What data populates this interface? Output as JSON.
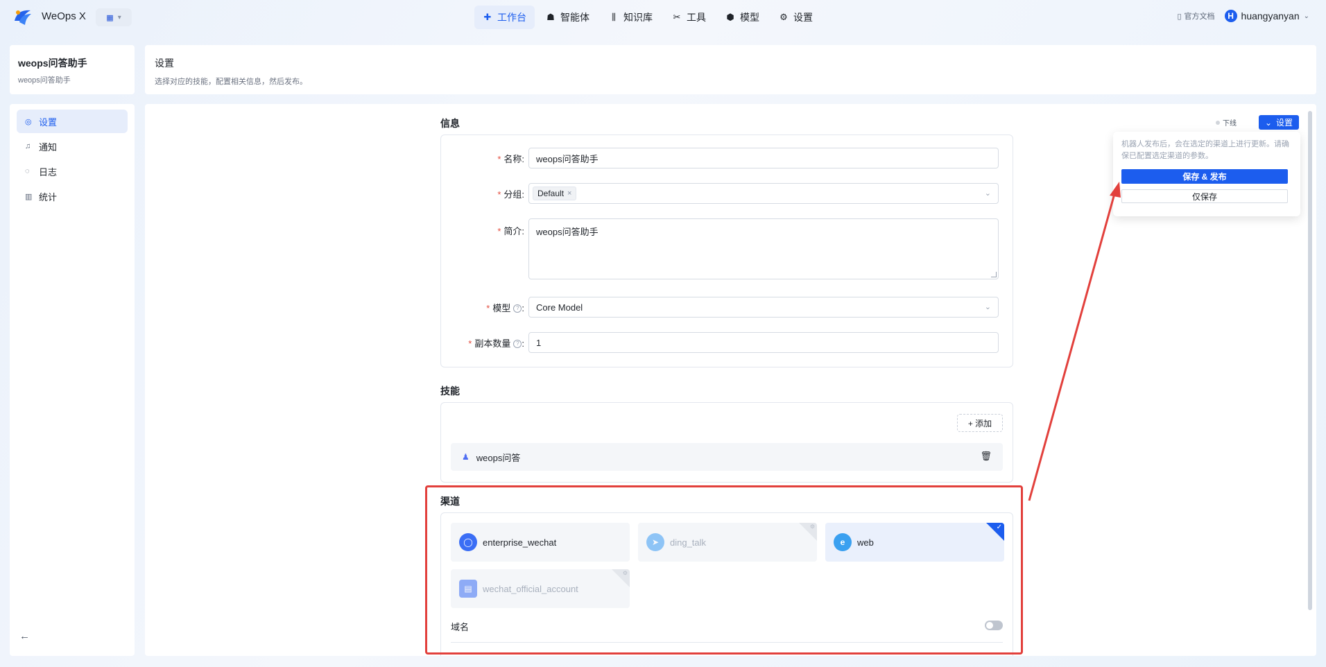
{
  "app": {
    "title": "WeOps X"
  },
  "nav": [
    {
      "label": "工作台",
      "icon": "robot-icon"
    },
    {
      "label": "智能体",
      "icon": "agent-icon"
    },
    {
      "label": "知识库",
      "icon": "library-icon"
    },
    {
      "label": "工具",
      "icon": "tools-icon"
    },
    {
      "label": "模型",
      "icon": "cube-icon"
    },
    {
      "label": "设置",
      "icon": "gear-icon"
    }
  ],
  "topright": {
    "doc_link": "官方文档",
    "avatar_letter": "H",
    "username": "huangyanyan"
  },
  "agent": {
    "name": "weops问答助手",
    "subtitle": "weops问答助手"
  },
  "sidebar": {
    "items": [
      {
        "label": "设置",
        "icon": "gear-icon"
      },
      {
        "label": "通知",
        "icon": "bell-icon"
      },
      {
        "label": "日志",
        "icon": "chat-icon"
      },
      {
        "label": "统计",
        "icon": "chart-icon"
      }
    ]
  },
  "header": {
    "title": "设置",
    "subtitle": "选择对应的技能，配置相关信息，然后发布。"
  },
  "info": {
    "section_title": "信息",
    "name_label": "名称:",
    "name_value": "weops问答助手",
    "group_label": "分组:",
    "group_tag": "Default",
    "intro_label": "简介:",
    "intro_value": "weops问答助手",
    "model_label": "模型",
    "model_value": "Core Model",
    "replica_label": "副本数量",
    "replica_value": "1",
    "colon": ":"
  },
  "skills": {
    "section_title": "技能",
    "add_label": "+ 添加",
    "items": [
      {
        "label": "weops问答"
      }
    ]
  },
  "channels": {
    "section_title": "渠道",
    "items": [
      {
        "label": "enterprise_wechat",
        "state": "enabled"
      },
      {
        "label": "ding_talk",
        "state": "disabled"
      },
      {
        "label": "web",
        "state": "selected"
      },
      {
        "label": "wechat_official_account",
        "state": "disabled"
      }
    ],
    "domain_label": "域名",
    "domain_toggle": false
  },
  "actions": {
    "offline_label": "下线",
    "settings_label": "设置"
  },
  "popover": {
    "text": "机器人发布后，会在选定的渠道上进行更新。请确保已配置选定渠道的参数。",
    "primary_label": "保存 & 发布",
    "secondary_label": "仅保存"
  },
  "colors": {
    "accent": "#1c5dee",
    "annotation": "#e2403c"
  }
}
